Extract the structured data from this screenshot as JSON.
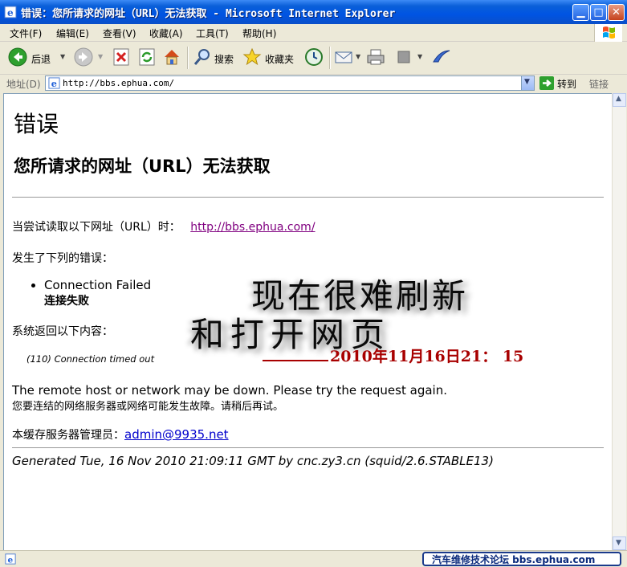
{
  "window": {
    "title": "错误：您所请求的网址（URL）无法获取 - Microsoft Internet Explorer"
  },
  "menu": [
    "文件(F)",
    "编辑(E)",
    "查看(V)",
    "收藏(A)",
    "工具(T)",
    "帮助(H)"
  ],
  "toolbar": {
    "back_label": "后退",
    "search_label": "搜索",
    "favorites_label": "收藏夹"
  },
  "address": {
    "label": "地址(D)",
    "url": "http://bbs.ephua.com/",
    "go_label": "转到",
    "links_label": "链接"
  },
  "page": {
    "heading": "错误",
    "subheading": "您所请求的网址（URL）无法获取",
    "try_text": "当尝试读取以下网址（URL）时：",
    "try_url": "http://bbs.ephua.com/",
    "error_intro": "发生了下列的错误：",
    "error_title": "Connection Failed",
    "error_sub": "连接失败",
    "returned_intro": "系统返回以下内容：",
    "timeout": "(110) Connection timed out",
    "remote_en": "The remote host or network may be down. Please try the request again.",
    "remote_cn": "您要连结的网络服务器或网络可能发生故障。请稍后再试。",
    "admin_label": "本缓存服务器管理员：",
    "admin_email": "admin@9935.net",
    "generated": "Generated Tue, 16 Nov 2010 21:09:11 GMT by cnc.zy3.cn (squid/2.6.STABLE13)"
  },
  "overlay": {
    "line1": "现在很难刷新",
    "line2": "和打开网页",
    "date": "2010年11月16日21：  15"
  },
  "status": {
    "watermark": "汽车维修技术论坛 bbs.ephua.com"
  },
  "colors": {
    "titlebar": "#0054e3",
    "visited_link": "#800080",
    "link": "#0000cc",
    "overlay_date": "#a80000"
  }
}
